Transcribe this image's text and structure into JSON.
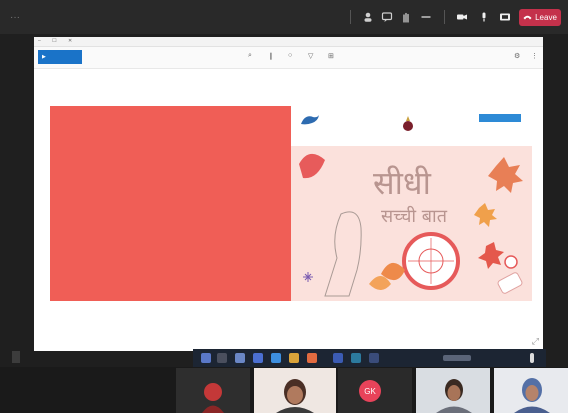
{
  "topbar": {
    "timer": "",
    "leave_label": "Leave",
    "icons": [
      "people-icon",
      "chat-icon",
      "raise-hand-icon",
      "more-icon",
      "camera-icon",
      "mic-icon",
      "share-icon"
    ]
  },
  "window": {
    "title": "",
    "controls": "– ☐ ✕"
  },
  "ribbon": {
    "present_label": "",
    "edit_label": "",
    "right_items": [
      "",
      ""
    ]
  },
  "slide": {
    "logo_tag": "",
    "logo_sub": "",
    "hindi_line1": "सीधी",
    "hindi_line2": "सच्ची बात"
  },
  "presenter": {
    "label": "",
    "tail": ""
  },
  "taskbar": {
    "clock_time": "",
    "clock_date": ""
  },
  "participants": [
    {
      "initials": "",
      "name": ""
    },
    {
      "initials": "",
      "name": ""
    },
    {
      "initials": "GK",
      "name": ""
    },
    {
      "initials": "",
      "name": ""
    },
    {
      "initials": "",
      "name": ""
    }
  ],
  "colors": {
    "leave": "#c4314b",
    "red_box": "#f05e56",
    "slide_art_bg": "#fbe1dc",
    "accent_blue": "#1a73c8"
  }
}
